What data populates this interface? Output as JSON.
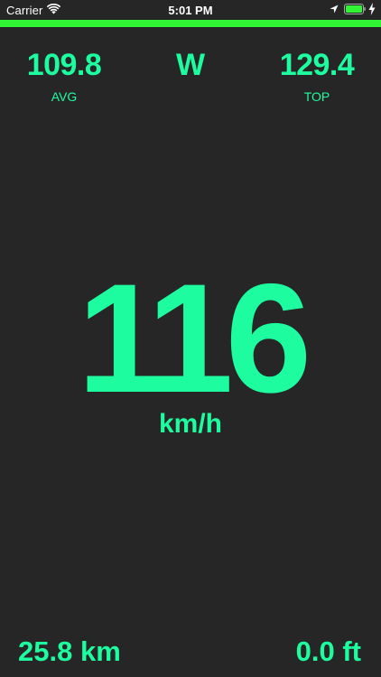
{
  "status_bar": {
    "carrier": "Carrier",
    "time": "5:01 PM",
    "icons": [
      "wifi-icon",
      "location-arrow-icon",
      "battery-icon",
      "charging-bolt-icon"
    ]
  },
  "colors": {
    "background": "#262626",
    "accent": "#1dfda0",
    "top_bar": "#2ff532",
    "status_text": "#ffffff"
  },
  "stats": {
    "avg": {
      "value": "109.8",
      "label": "AVG"
    },
    "heading": "W",
    "top": {
      "value": "129.4",
      "label": "TOP"
    }
  },
  "speed": {
    "value": "116",
    "unit": "km/h"
  },
  "bottom": {
    "distance": "25.8 km",
    "altitude": "0.0 ft"
  }
}
